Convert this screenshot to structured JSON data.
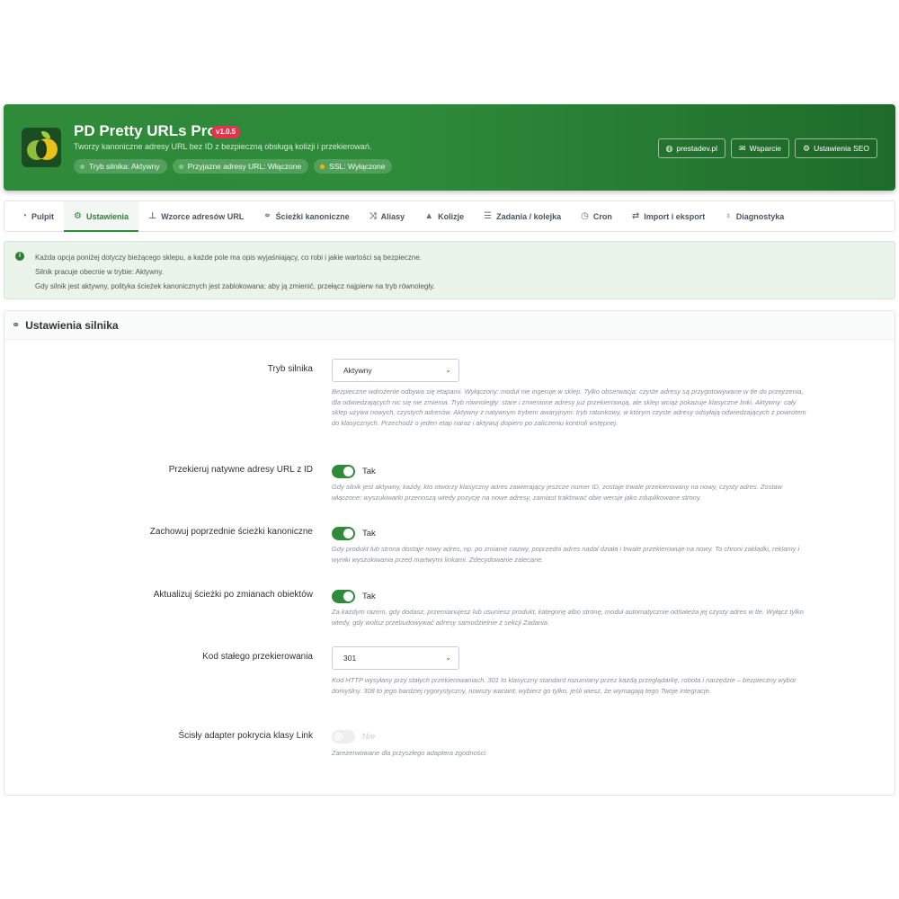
{
  "header": {
    "title": "PD Pretty URLs Pro",
    "version": "v1.0.5",
    "subtitle": "Tworzy kanoniczne adresy URL bez ID z bezpieczną obsługą kolizji i przekierowań.",
    "pills": [
      {
        "label": "Tryb silnika: Aktywny",
        "dot_color": "#7fd07f"
      },
      {
        "label": "Przyjazne adresy URL: Włączone",
        "dot_color": "#7fd07f"
      },
      {
        "label": "SSL: Wyłączone",
        "dot_color": "#f4b400"
      }
    ],
    "buttons": [
      {
        "label": "prestadev.pl",
        "icon": "globe-icon"
      },
      {
        "label": "Wsparcie",
        "icon": "envelope-icon"
      },
      {
        "label": "Ustawienia SEO",
        "icon": "gears-icon"
      }
    ]
  },
  "tabs": [
    {
      "label": "Pulpit",
      "icon": "dashboard-icon",
      "active": false
    },
    {
      "label": "Ustawienia",
      "icon": "gears-icon",
      "active": true
    },
    {
      "label": "Wzorce adresów URL",
      "icon": "sitemap-icon",
      "active": false
    },
    {
      "label": "Ścieżki kanoniczne",
      "icon": "link-icon",
      "active": false
    },
    {
      "label": "Aliasy",
      "icon": "shuffle-icon",
      "active": false
    },
    {
      "label": "Kolizje",
      "icon": "warning-icon",
      "active": false
    },
    {
      "label": "Zadania / kolejka",
      "icon": "tasks-icon",
      "active": false
    },
    {
      "label": "Cron",
      "icon": "clock-icon",
      "active": false
    },
    {
      "label": "Import i eksport",
      "icon": "exchange-icon",
      "active": false
    },
    {
      "label": "Diagnostyka",
      "icon": "stethoscope-icon",
      "active": false
    }
  ],
  "info": {
    "lines": [
      "Każda opcja poniżej dotyczy bieżącego sklepu, a każde pole ma opis wyjaśniający, co robi i jakie wartości są bezpieczne.",
      "Silnik pracuje obecnie w trybie: Aktywny.",
      "Gdy silnik jest aktywny, polityka ścieżek kanonicznych jest zablokowana; aby ją zmienić, przełącz najpierw na tryb równoległy."
    ]
  },
  "panel": {
    "title": "Ustawienia silnika",
    "fields": [
      {
        "label": "Tryb silnika",
        "type": "select",
        "value": "Aktywny",
        "help": "Bezpieczne wdrożenie odbywa się etapami. Wyłączony: moduł nie ingeruje w sklep. Tylko obserwacja: czyste adresy są przygotowywane w tle do przejrzenia, dla odwiedzających nic się nie zmienia. Tryb równoległy: stare i zmienione adresy już przekierowują, ale sklep wciąż pokazuje klasyczne linki. Aktywny: cały sklep używa nowych, czystych adresów. Aktywny z natywnym trybem awaryjnym: tryb ratunkowy, w którym czyste adresy odsyłają odwiedzających z powrotem do klasycznych. Przechodź o jeden etap naraz i aktywuj dopiero po zaliczeniu kontroli wstępnej."
      },
      {
        "label": "Przekieruj natywne adresy URL z ID",
        "type": "toggle",
        "on": true,
        "value": "Tak",
        "help": "Gdy silnik jest aktywny, każdy, kto otworzy klasyczny adres zawierający jeszcze numer ID, zostaje trwale przekierowany na nowy, czysty adres. Zostaw włączone: wyszukiwarki przenoszą wtedy pozycję na nowe adresy, zamiast traktować obie wersje jako zduplikowane strony."
      },
      {
        "label": "Zachowuj poprzednie ścieżki kanoniczne",
        "type": "toggle",
        "on": true,
        "value": "Tak",
        "help": "Gdy produkt lub strona dostaje nowy adres, np. po zmianie nazwy, poprzedni adres nadal działa i trwale przekierowuje na nowy. To chroni zakładki, reklamy i wyniki wyszukiwania przed martwymi linkami. Zdecydowanie zalecane."
      },
      {
        "label": "Aktualizuj ścieżki po zmianach obiektów",
        "type": "toggle",
        "on": true,
        "value": "Tak",
        "help": "Za każdym razem, gdy dodasz, przemianujesz lub usuniesz produkt, kategorię albo stronę, moduł automatycznie odświeża jej czysty adres w tle. Wyłącz tylko wtedy, gdy wolisz przebudowywać adresy samodzielnie z sekcji Zadania."
      },
      {
        "label": "Kod stałego przekierowania",
        "type": "select",
        "value": "301",
        "help": "Kod HTTP wysyłany przy stałych przekierowaniach. 301 to klasyczny standard rozumiany przez każdą przeglądarkę, robota i narzędzie – bezpieczny wybór domyślny. 308 to jego bardziej rygorystyczny, nowszy wariant; wybierz go tylko, jeśli wiesz, że wymagają tego Twoje integracje."
      },
      {
        "label": "Ścisły adapter pokrycia klasy Link",
        "type": "toggle",
        "on": false,
        "value": "Nie",
        "help": "Zarezerwowane dla przyszłego adaptera zgodności."
      }
    ]
  }
}
